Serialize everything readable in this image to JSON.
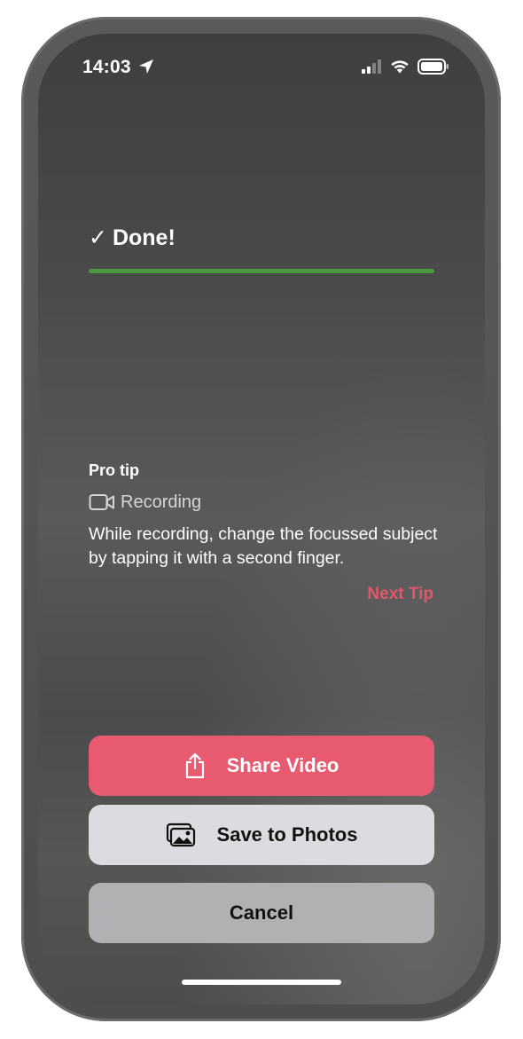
{
  "status_bar": {
    "time": "14:03",
    "icons": [
      "location-arrow-icon",
      "cellular-signal-icon",
      "wifi-icon",
      "battery-icon"
    ]
  },
  "progress": {
    "check_glyph": "✓",
    "label": "Done!",
    "value": 1.0,
    "color": "#4a9a3f"
  },
  "tip": {
    "title": "Pro tip",
    "category_icon": "video-camera-icon",
    "category": "Recording",
    "body": "While recording, change the focussed subject by tapping it with a second finger.",
    "next_label": "Next Tip",
    "accent": "#e4566b"
  },
  "actions": {
    "share": {
      "label": "Share Video",
      "icon": "share-icon",
      "color": "#e85a6f"
    },
    "save": {
      "label": "Save to Photos",
      "icon": "photos-icon",
      "color": "#dcdbe0"
    },
    "cancel": {
      "label": "Cancel",
      "color": "#b1b1b4"
    }
  }
}
